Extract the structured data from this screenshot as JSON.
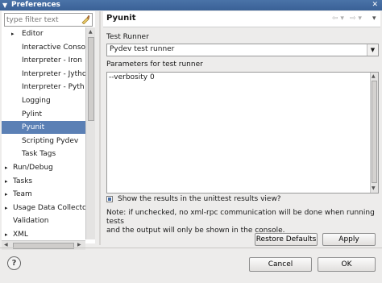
{
  "window": {
    "title": "Preferences",
    "menu_glyph": "▼",
    "close_glyph": "✕"
  },
  "filter": {
    "placeholder": "type filter text",
    "value": "",
    "clear_icon": "clear-filter-icon"
  },
  "tree": {
    "items": [
      {
        "label": "Editor",
        "arrow": "▸",
        "indent": 2,
        "selected": false
      },
      {
        "label": "Interactive Conso",
        "arrow": "",
        "indent": 3,
        "selected": false
      },
      {
        "label": "Interpreter - Iron",
        "arrow": "",
        "indent": 3,
        "selected": false
      },
      {
        "label": "Interpreter - Jytho",
        "arrow": "",
        "indent": 3,
        "selected": false
      },
      {
        "label": "Interpreter - Pyth",
        "arrow": "",
        "indent": 3,
        "selected": false
      },
      {
        "label": "Logging",
        "arrow": "",
        "indent": 3,
        "selected": false
      },
      {
        "label": "Pylint",
        "arrow": "",
        "indent": 3,
        "selected": false
      },
      {
        "label": "Pyunit",
        "arrow": "",
        "indent": 3,
        "selected": true
      },
      {
        "label": "Scripting Pydev",
        "arrow": "",
        "indent": 3,
        "selected": false
      },
      {
        "label": "Task Tags",
        "arrow": "",
        "indent": 3,
        "selected": false
      },
      {
        "label": "Run/Debug",
        "arrow": "▸",
        "indent": 1,
        "selected": false
      },
      {
        "label": "Tasks",
        "arrow": "▸",
        "indent": 1,
        "selected": false
      },
      {
        "label": "Team",
        "arrow": "▸",
        "indent": 1,
        "selected": false
      },
      {
        "label": "Usage Data Collecto",
        "arrow": "▸",
        "indent": 1,
        "selected": false
      },
      {
        "label": "Validation",
        "arrow": "",
        "indent": 1,
        "selected": false
      },
      {
        "label": "XML",
        "arrow": "▸",
        "indent": 1,
        "selected": false
      }
    ]
  },
  "page": {
    "title": "Pyunit",
    "nav_back": "⇦ ▾",
    "nav_forward": "⇨ ▾",
    "nav_menu": "▾",
    "test_runner_label": "Test Runner",
    "test_runner_value": "Pydev test runner",
    "params_label": "Parameters for test runner",
    "params_value": "--verbosity 0",
    "show_results_label": "Show the results in the unittest results view?",
    "show_results_checked": true,
    "note_line1": "Note: if unchecked, no xml-rpc communication will be done when running tests",
    "note_line2": "and the output will only be shown in the console.",
    "restore_defaults": "Restore Defaults",
    "apply": "Apply"
  },
  "footer": {
    "help_glyph": "?",
    "cancel": "Cancel",
    "ok": "OK"
  }
}
